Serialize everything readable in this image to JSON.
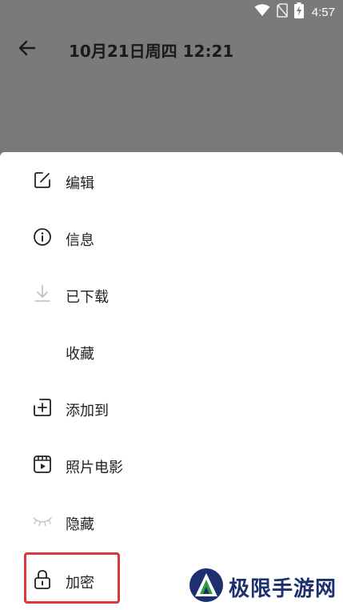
{
  "status_bar": {
    "time": "4:57",
    "icons": [
      "wifi-icon",
      "no-sim-icon",
      "battery-charging-icon"
    ]
  },
  "app_bar": {
    "back_icon": "arrow-back-icon",
    "title": "10月21日周四 12:21"
  },
  "menu": {
    "items": [
      {
        "icon": "edit-icon",
        "label": "编辑"
      },
      {
        "icon": "info-icon",
        "label": "信息"
      },
      {
        "icon": "download-icon",
        "label": "已下载"
      },
      {
        "icon": "",
        "label": "收藏"
      },
      {
        "icon": "add-to-icon",
        "label": "添加到"
      },
      {
        "icon": "movie-icon",
        "label": "照片电影"
      },
      {
        "icon": "hide-icon",
        "label": "隐藏"
      },
      {
        "icon": "lock-icon",
        "label": "加密"
      }
    ]
  },
  "watermark": {
    "text": "极限手游网"
  },
  "colors": {
    "scrim": "#7a7a7a",
    "sheet": "#ffffff",
    "highlight": "#d9383a",
    "watermark": "#1c2f6e"
  }
}
